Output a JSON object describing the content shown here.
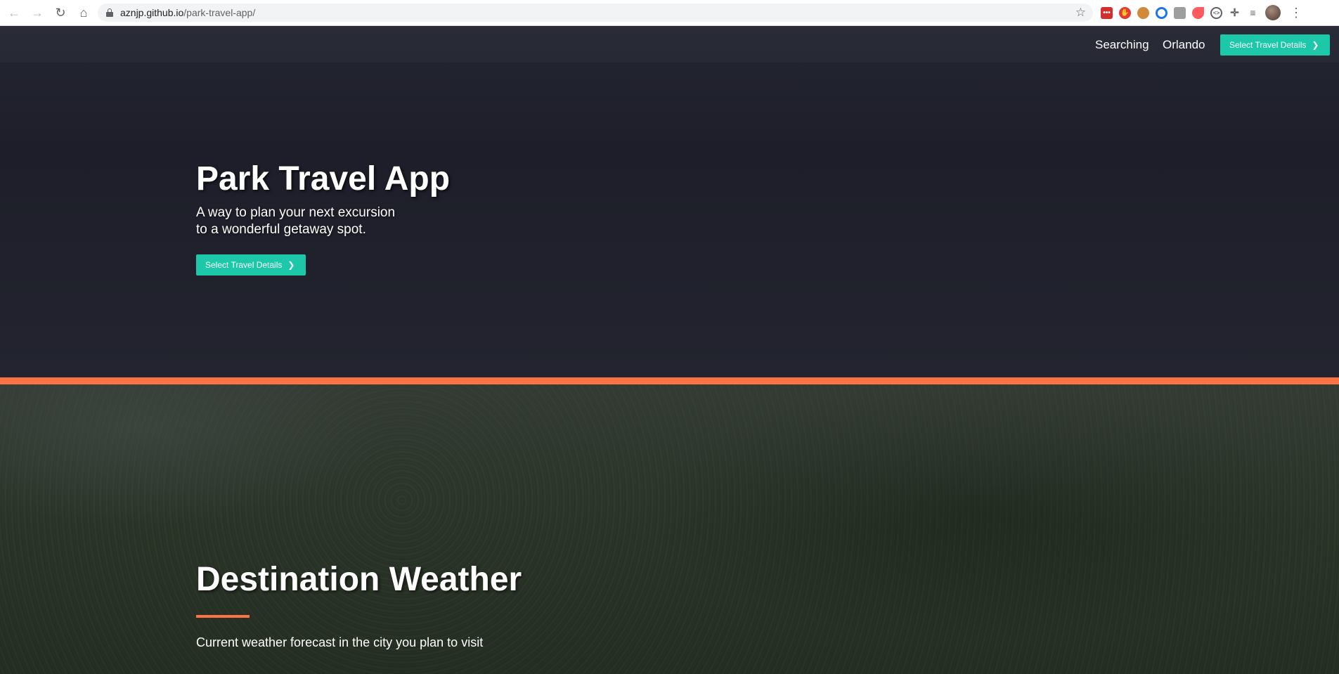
{
  "browser": {
    "url_host": "aznjp.github.io",
    "url_path": "/park-travel-app/",
    "back_icon": "arrow-left-icon",
    "forward_icon": "arrow-right-icon",
    "reload_icon": "reload-icon",
    "home_icon": "home-icon",
    "extensions": [
      "dashlane-icon",
      "adblock-icon",
      "cookie-icon",
      "circle-o-icon",
      "screen-cast-icon",
      "arrow-ext-icon",
      "code-icon",
      "puzzle-icon",
      "media-list-icon"
    ]
  },
  "nav": {
    "link1": "Searching",
    "link2": "Orlando",
    "cta": "Select Travel Details"
  },
  "hero": {
    "title": "Park Travel App",
    "subtitle_line1": "A way to plan your next excursion",
    "subtitle_line2": "to a wonderful getaway spot.",
    "button": "Select Travel Details"
  },
  "weather": {
    "title": "Destination Weather",
    "subtitle": "Current weather forecast in the city you plan to visit"
  },
  "colors": {
    "accent": "#1cc8a8",
    "divider": "#fd7346",
    "hero_bg": "#1f2029"
  }
}
